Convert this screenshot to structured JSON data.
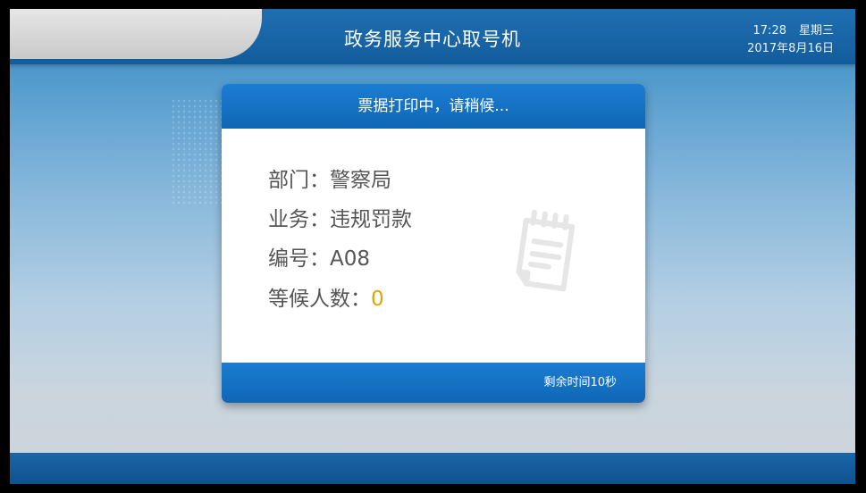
{
  "header": {
    "title": "政务服务中心取号机",
    "time": "17:28",
    "weekday": "星期三",
    "date": "2017年8月16日"
  },
  "dialog": {
    "title": "票据打印中，请稍候...",
    "rows": [
      {
        "label": "部门：",
        "value": "警察局"
      },
      {
        "label": "业务：",
        "value": "违规罚款"
      },
      {
        "label": "编号：",
        "value": "A08"
      },
      {
        "label": "等候人数：",
        "value": "0"
      }
    ],
    "icon": "receipt-icon",
    "countdown": "剩余时间10秒"
  },
  "colors": {
    "header_blue": "#125c9c",
    "dialog_blue": "#1677c8",
    "highlight": "#e3a400",
    "text_gray": "#555555"
  }
}
